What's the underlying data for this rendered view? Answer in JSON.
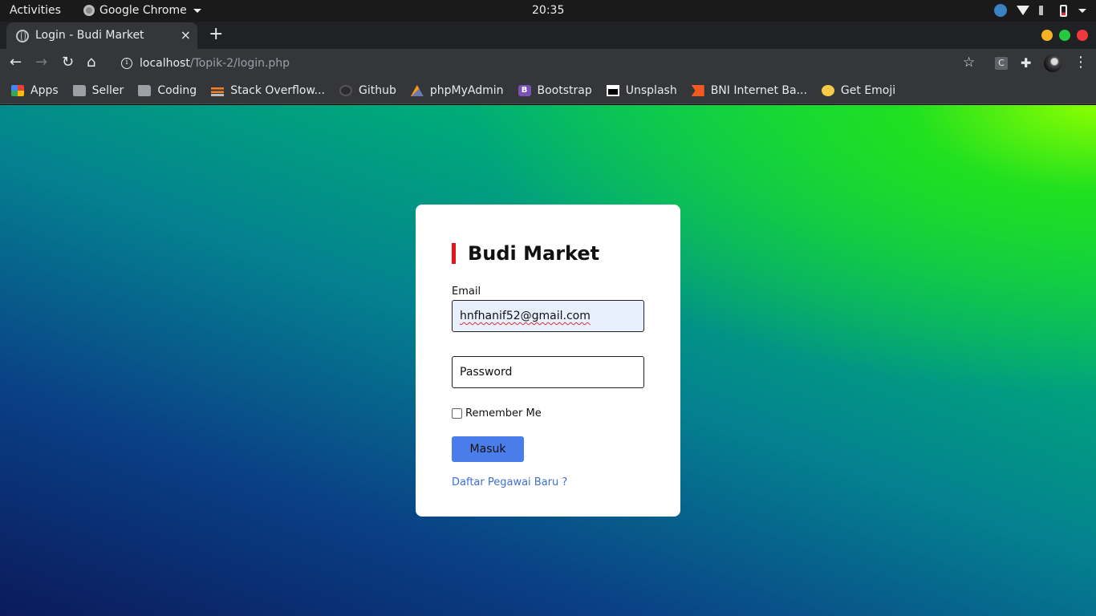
{
  "system_bar": {
    "activities": "Activities",
    "app_name": "Google Chrome",
    "clock": "20:35"
  },
  "browser": {
    "tab": {
      "title": "Login - Budi Market",
      "close": "×"
    },
    "new_tab": "+",
    "url": {
      "host": "localhost",
      "path": "/Topik-2/login.php"
    },
    "extension_letter": "C",
    "bookmarks": [
      {
        "label": "Apps",
        "icon": "apps-icon"
      },
      {
        "label": "Seller",
        "icon": "folder-icon"
      },
      {
        "label": "Coding",
        "icon": "folder-icon"
      },
      {
        "label": "Stack Overflow...",
        "icon": "stackoverflow-icon"
      },
      {
        "label": "Github",
        "icon": "github-icon"
      },
      {
        "label": "phpMyAdmin",
        "icon": "phpmyadmin-icon"
      },
      {
        "label": "Bootstrap",
        "icon": "bootstrap-icon"
      },
      {
        "label": "Unsplash",
        "icon": "unsplash-icon"
      },
      {
        "label": "BNI Internet Ba...",
        "icon": "bni-icon"
      },
      {
        "label": "Get Emoji",
        "icon": "emoji-icon"
      }
    ]
  },
  "login": {
    "brand": "Budi Market",
    "email_label": "Email",
    "email_value": "hnfhanif52@gmail.com",
    "password_placeholder": "Password",
    "remember_label": "Remember Me",
    "submit_label": "Masuk",
    "register_link": "Daftar Pegawai Baru ?"
  },
  "colors": {
    "accent_bar": "#e3141c",
    "button": "#4a7de9",
    "link": "#3f6fd0",
    "autofill_bg": "#e8f0fe"
  }
}
